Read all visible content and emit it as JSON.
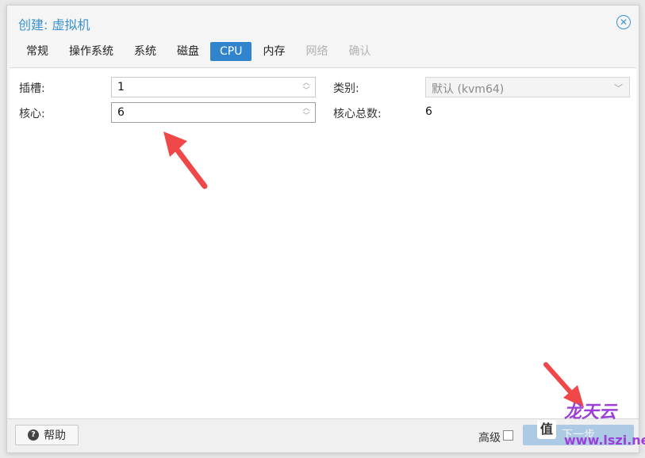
{
  "dialog": {
    "title": "创建: 虚拟机",
    "close_icon": "close-circle-icon"
  },
  "tabs": [
    {
      "label": "常规",
      "state": "normal"
    },
    {
      "label": "操作系统",
      "state": "normal"
    },
    {
      "label": "系统",
      "state": "normal"
    },
    {
      "label": "磁盘",
      "state": "normal"
    },
    {
      "label": "CPU",
      "state": "active"
    },
    {
      "label": "内存",
      "state": "normal"
    },
    {
      "label": "网络",
      "state": "disabled"
    },
    {
      "label": "确认",
      "state": "disabled"
    }
  ],
  "cpu": {
    "sockets_label": "插槽:",
    "sockets_value": "1",
    "cores_label": "核心:",
    "cores_value": "6",
    "type_label": "类别:",
    "type_value": "默认 (kvm64)",
    "total_cores_label": "核心总数:",
    "total_cores_value": "6"
  },
  "footer": {
    "help_label": "帮助",
    "advanced_label": "高级",
    "advanced_checked": false,
    "next_label": "下一步"
  },
  "watermark": {
    "text_top": "龙天云",
    "text_bottom": "www.lszi.net",
    "badge": "值"
  },
  "colors": {
    "accent": "#2f84cd",
    "title": "#3892d4",
    "arrow": "#f04848"
  }
}
